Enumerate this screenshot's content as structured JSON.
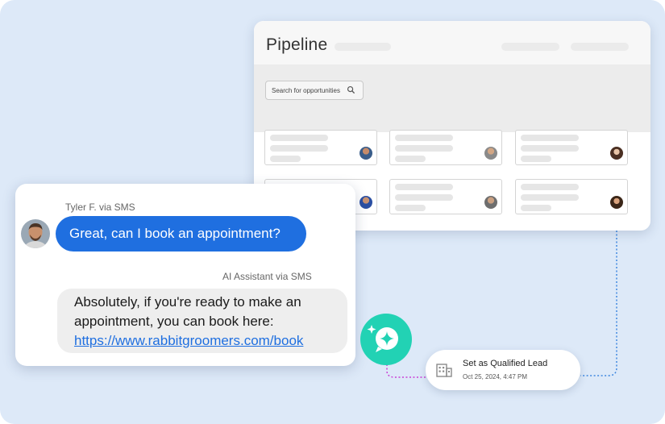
{
  "pipeline": {
    "title": "Pipeline",
    "search_placeholder": "Search for opportunities"
  },
  "sms": {
    "user_meta": "Tyler F. via SMS",
    "user_message": "Great, can I book an appointment?",
    "ai_meta": "AI Assistant via SMS",
    "ai_message": "Absolutely, if you're ready to make an appointment, you can book here:",
    "ai_link": "https://www.rabbitgroomers.com/book"
  },
  "lead": {
    "title": "Set as Qualified Lead",
    "date": "Oct 25, 2024, 4:47 PM"
  },
  "colors": {
    "background": "#dde9f8",
    "user_bubble": "#1f6fe0",
    "ai_badge": "#22d2b4",
    "connector": "#c93fd6",
    "pipeline_connector": "#3f88e0"
  },
  "icons": {
    "search": "search-icon",
    "ai_badge": "sparkle-chat-icon",
    "lead": "building-icon"
  }
}
